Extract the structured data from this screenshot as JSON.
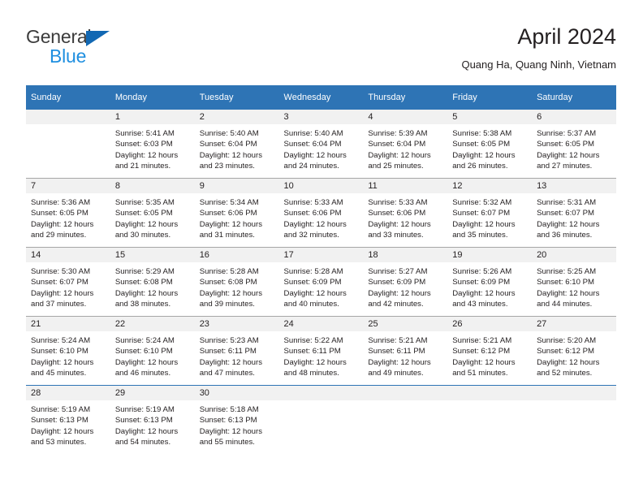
{
  "brand": {
    "name_part1": "General",
    "name_part2": "Blue",
    "triangle_color": "#1268b3",
    "blue_color": "#1f8fe0"
  },
  "header": {
    "title": "April 2024",
    "location": "Quang Ha, Quang Ninh, Vietnam"
  },
  "theme": {
    "header_bg": "#2e74b5",
    "daynum_bg": "#f1f1f1",
    "row_divider": "#a6a6a6",
    "text": "#231f20"
  },
  "weekdays": [
    "Sunday",
    "Monday",
    "Tuesday",
    "Wednesday",
    "Thursday",
    "Friday",
    "Saturday"
  ],
  "weeks": [
    {
      "days": [
        {
          "num": "",
          "empty": true,
          "sunrise": "",
          "sunset": "",
          "daylight_line1": "",
          "daylight_line2": ""
        },
        {
          "num": "1",
          "empty": false,
          "sunrise": "Sunrise: 5:41 AM",
          "sunset": "Sunset: 6:03 PM",
          "daylight_line1": "Daylight: 12 hours",
          "daylight_line2": "and 21 minutes."
        },
        {
          "num": "2",
          "empty": false,
          "sunrise": "Sunrise: 5:40 AM",
          "sunset": "Sunset: 6:04 PM",
          "daylight_line1": "Daylight: 12 hours",
          "daylight_line2": "and 23 minutes."
        },
        {
          "num": "3",
          "empty": false,
          "sunrise": "Sunrise: 5:40 AM",
          "sunset": "Sunset: 6:04 PM",
          "daylight_line1": "Daylight: 12 hours",
          "daylight_line2": "and 24 minutes."
        },
        {
          "num": "4",
          "empty": false,
          "sunrise": "Sunrise: 5:39 AM",
          "sunset": "Sunset: 6:04 PM",
          "daylight_line1": "Daylight: 12 hours",
          "daylight_line2": "and 25 minutes."
        },
        {
          "num": "5",
          "empty": false,
          "sunrise": "Sunrise: 5:38 AM",
          "sunset": "Sunset: 6:05 PM",
          "daylight_line1": "Daylight: 12 hours",
          "daylight_line2": "and 26 minutes."
        },
        {
          "num": "6",
          "empty": false,
          "sunrise": "Sunrise: 5:37 AM",
          "sunset": "Sunset: 6:05 PM",
          "daylight_line1": "Daylight: 12 hours",
          "daylight_line2": "and 27 minutes."
        }
      ]
    },
    {
      "days": [
        {
          "num": "7",
          "empty": false,
          "sunrise": "Sunrise: 5:36 AM",
          "sunset": "Sunset: 6:05 PM",
          "daylight_line1": "Daylight: 12 hours",
          "daylight_line2": "and 29 minutes."
        },
        {
          "num": "8",
          "empty": false,
          "sunrise": "Sunrise: 5:35 AM",
          "sunset": "Sunset: 6:05 PM",
          "daylight_line1": "Daylight: 12 hours",
          "daylight_line2": "and 30 minutes."
        },
        {
          "num": "9",
          "empty": false,
          "sunrise": "Sunrise: 5:34 AM",
          "sunset": "Sunset: 6:06 PM",
          "daylight_line1": "Daylight: 12 hours",
          "daylight_line2": "and 31 minutes."
        },
        {
          "num": "10",
          "empty": false,
          "sunrise": "Sunrise: 5:33 AM",
          "sunset": "Sunset: 6:06 PM",
          "daylight_line1": "Daylight: 12 hours",
          "daylight_line2": "and 32 minutes."
        },
        {
          "num": "11",
          "empty": false,
          "sunrise": "Sunrise: 5:33 AM",
          "sunset": "Sunset: 6:06 PM",
          "daylight_line1": "Daylight: 12 hours",
          "daylight_line2": "and 33 minutes."
        },
        {
          "num": "12",
          "empty": false,
          "sunrise": "Sunrise: 5:32 AM",
          "sunset": "Sunset: 6:07 PM",
          "daylight_line1": "Daylight: 12 hours",
          "daylight_line2": "and 35 minutes."
        },
        {
          "num": "13",
          "empty": false,
          "sunrise": "Sunrise: 5:31 AM",
          "sunset": "Sunset: 6:07 PM",
          "daylight_line1": "Daylight: 12 hours",
          "daylight_line2": "and 36 minutes."
        }
      ]
    },
    {
      "days": [
        {
          "num": "14",
          "empty": false,
          "sunrise": "Sunrise: 5:30 AM",
          "sunset": "Sunset: 6:07 PM",
          "daylight_line1": "Daylight: 12 hours",
          "daylight_line2": "and 37 minutes."
        },
        {
          "num": "15",
          "empty": false,
          "sunrise": "Sunrise: 5:29 AM",
          "sunset": "Sunset: 6:08 PM",
          "daylight_line1": "Daylight: 12 hours",
          "daylight_line2": "and 38 minutes."
        },
        {
          "num": "16",
          "empty": false,
          "sunrise": "Sunrise: 5:28 AM",
          "sunset": "Sunset: 6:08 PM",
          "daylight_line1": "Daylight: 12 hours",
          "daylight_line2": "and 39 minutes."
        },
        {
          "num": "17",
          "empty": false,
          "sunrise": "Sunrise: 5:28 AM",
          "sunset": "Sunset: 6:09 PM",
          "daylight_line1": "Daylight: 12 hours",
          "daylight_line2": "and 40 minutes."
        },
        {
          "num": "18",
          "empty": false,
          "sunrise": "Sunrise: 5:27 AM",
          "sunset": "Sunset: 6:09 PM",
          "daylight_line1": "Daylight: 12 hours",
          "daylight_line2": "and 42 minutes."
        },
        {
          "num": "19",
          "empty": false,
          "sunrise": "Sunrise: 5:26 AM",
          "sunset": "Sunset: 6:09 PM",
          "daylight_line1": "Daylight: 12 hours",
          "daylight_line2": "and 43 minutes."
        },
        {
          "num": "20",
          "empty": false,
          "sunrise": "Sunrise: 5:25 AM",
          "sunset": "Sunset: 6:10 PM",
          "daylight_line1": "Daylight: 12 hours",
          "daylight_line2": "and 44 minutes."
        }
      ]
    },
    {
      "days": [
        {
          "num": "21",
          "empty": false,
          "sunrise": "Sunrise: 5:24 AM",
          "sunset": "Sunset: 6:10 PM",
          "daylight_line1": "Daylight: 12 hours",
          "daylight_line2": "and 45 minutes."
        },
        {
          "num": "22",
          "empty": false,
          "sunrise": "Sunrise: 5:24 AM",
          "sunset": "Sunset: 6:10 PM",
          "daylight_line1": "Daylight: 12 hours",
          "daylight_line2": "and 46 minutes."
        },
        {
          "num": "23",
          "empty": false,
          "sunrise": "Sunrise: 5:23 AM",
          "sunset": "Sunset: 6:11 PM",
          "daylight_line1": "Daylight: 12 hours",
          "daylight_line2": "and 47 minutes."
        },
        {
          "num": "24",
          "empty": false,
          "sunrise": "Sunrise: 5:22 AM",
          "sunset": "Sunset: 6:11 PM",
          "daylight_line1": "Daylight: 12 hours",
          "daylight_line2": "and 48 minutes."
        },
        {
          "num": "25",
          "empty": false,
          "sunrise": "Sunrise: 5:21 AM",
          "sunset": "Sunset: 6:11 PM",
          "daylight_line1": "Daylight: 12 hours",
          "daylight_line2": "and 49 minutes."
        },
        {
          "num": "26",
          "empty": false,
          "sunrise": "Sunrise: 5:21 AM",
          "sunset": "Sunset: 6:12 PM",
          "daylight_line1": "Daylight: 12 hours",
          "daylight_line2": "and 51 minutes."
        },
        {
          "num": "27",
          "empty": false,
          "sunrise": "Sunrise: 5:20 AM",
          "sunset": "Sunset: 6:12 PM",
          "daylight_line1": "Daylight: 12 hours",
          "daylight_line2": "and 52 minutes."
        }
      ]
    },
    {
      "days": [
        {
          "num": "28",
          "empty": false,
          "sunrise": "Sunrise: 5:19 AM",
          "sunset": "Sunset: 6:13 PM",
          "daylight_line1": "Daylight: 12 hours",
          "daylight_line2": "and 53 minutes."
        },
        {
          "num": "29",
          "empty": false,
          "sunrise": "Sunrise: 5:19 AM",
          "sunset": "Sunset: 6:13 PM",
          "daylight_line1": "Daylight: 12 hours",
          "daylight_line2": "and 54 minutes."
        },
        {
          "num": "30",
          "empty": false,
          "sunrise": "Sunrise: 5:18 AM",
          "sunset": "Sunset: 6:13 PM",
          "daylight_line1": "Daylight: 12 hours",
          "daylight_line2": "and 55 minutes."
        },
        {
          "num": "",
          "empty": true,
          "sunrise": "",
          "sunset": "",
          "daylight_line1": "",
          "daylight_line2": ""
        },
        {
          "num": "",
          "empty": true,
          "sunrise": "",
          "sunset": "",
          "daylight_line1": "",
          "daylight_line2": ""
        },
        {
          "num": "",
          "empty": true,
          "sunrise": "",
          "sunset": "",
          "daylight_line1": "",
          "daylight_line2": ""
        },
        {
          "num": "",
          "empty": true,
          "sunrise": "",
          "sunset": "",
          "daylight_line1": "",
          "daylight_line2": ""
        }
      ]
    }
  ]
}
